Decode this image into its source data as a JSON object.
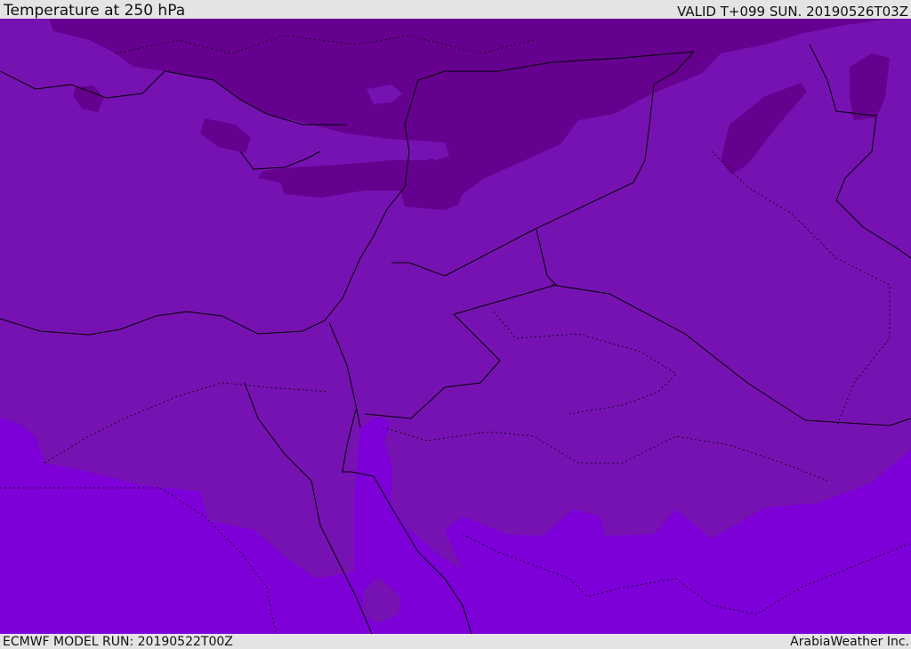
{
  "header": {
    "title": "Temperature at 250 hPa",
    "valid_time": "VALID T+099 SUN. 20190526T03Z"
  },
  "footer": {
    "model_run": "ECMWF MODEL RUN: 20190522T00Z",
    "credit": "ArabiaWeather Inc."
  },
  "colors": {
    "cold": "#66008f",
    "mid": "#7712b2",
    "warm": "#7d00d9",
    "borders": "#000000"
  }
}
